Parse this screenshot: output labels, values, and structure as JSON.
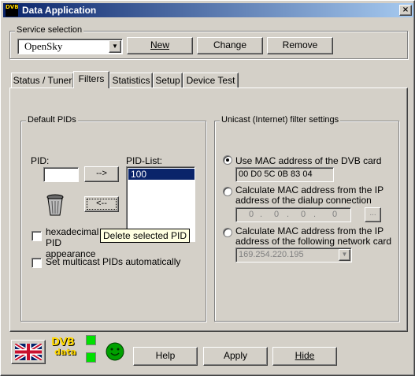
{
  "window": {
    "title": "Data Application",
    "close_glyph": "×",
    "icon_text": "DVB"
  },
  "service": {
    "group_label": "Service selection",
    "selected": "OpenSky",
    "new_label": "New",
    "change_label": "Change",
    "remove_label": "Remove"
  },
  "tabs": [
    {
      "label": "Status / Tuner"
    },
    {
      "label": "Filters"
    },
    {
      "label": "Statistics"
    },
    {
      "label": "Setup"
    },
    {
      "label": "Device Test"
    }
  ],
  "pids": {
    "group_label": "Default PIDs",
    "pid_label": "PID:",
    "pid_value": "",
    "pidlist_label": "PID-List:",
    "pid_list": [
      "100"
    ],
    "add_label": "-->",
    "remove_label": "<--",
    "tooltip": "Delete selected PID",
    "hex_label": "hexadecimal PID appearance",
    "multicast_label": "Set multicast PIDs automatically"
  },
  "unicast": {
    "group_label": "Unicast (Internet) filter settings",
    "opt1_label": "Use MAC address of the DVB card",
    "mac_value": "00 D0 5C 0B 83 04",
    "opt2_label_line1": "Calculate MAC address from the IP",
    "opt2_label_line2": "address of the dialup connection",
    "ip_parts": [
      "0",
      "0",
      "0",
      "0"
    ],
    "ip_button": "...",
    "opt3_label_line1": "Calculate MAC address from the IP",
    "opt3_label_line2": "address of the following network card",
    "network_card": "169.254.220.195"
  },
  "bottom": {
    "help_label": "Help",
    "apply_label": "Apply",
    "hide_label": "Hide",
    "logo_top": "DVB",
    "logo_bottom": "data"
  }
}
